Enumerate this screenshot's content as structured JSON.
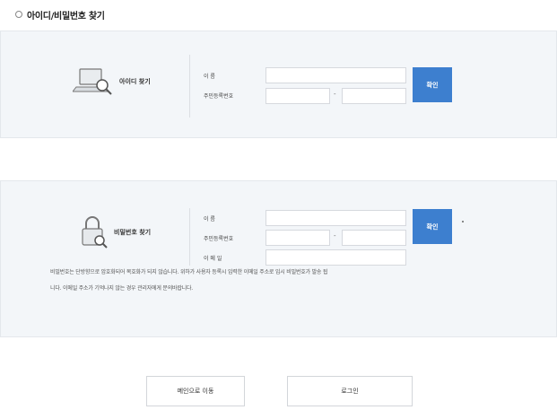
{
  "page": {
    "title": "아이디/비밀번호 찾기"
  },
  "find_id": {
    "label": "아이디 찾기",
    "icon": "laptop-magnifier-icon",
    "name_label": "이    름",
    "ssn_label": "주민등록번호",
    "ssn_separator": "-",
    "name_value": "",
    "ssn_front_value": "",
    "ssn_back_value": "",
    "confirm_label": "확인"
  },
  "find_password": {
    "label": "비밀번호 찾기",
    "icon": "padlock-magnifier-icon",
    "name_label": "이    름",
    "ssn_label": "주민등록번호",
    "ssn_separator": "-",
    "email_label": "이 메 일",
    "name_value": "",
    "ssn_front_value": "",
    "ssn_back_value": "",
    "email_value": "",
    "confirm_label": "확인",
    "notice_line1": "비밀번호는 단방향으로 암호화되어 복호화가 되지 않습니다. 위하가 사용자 등록시 입력한 이메일 주소로 임시 비밀번호가 발송 됩",
    "notice_line2": "니다. 이메일 주소가 기억나지 않는 경우 관리자에게 문의바랍니다."
  },
  "bottom": {
    "main_label": "메인으로 이동",
    "login_label": "로그인"
  },
  "colors": {
    "accent": "#3d7fcf",
    "panel_bg": "#f3f6f9"
  }
}
